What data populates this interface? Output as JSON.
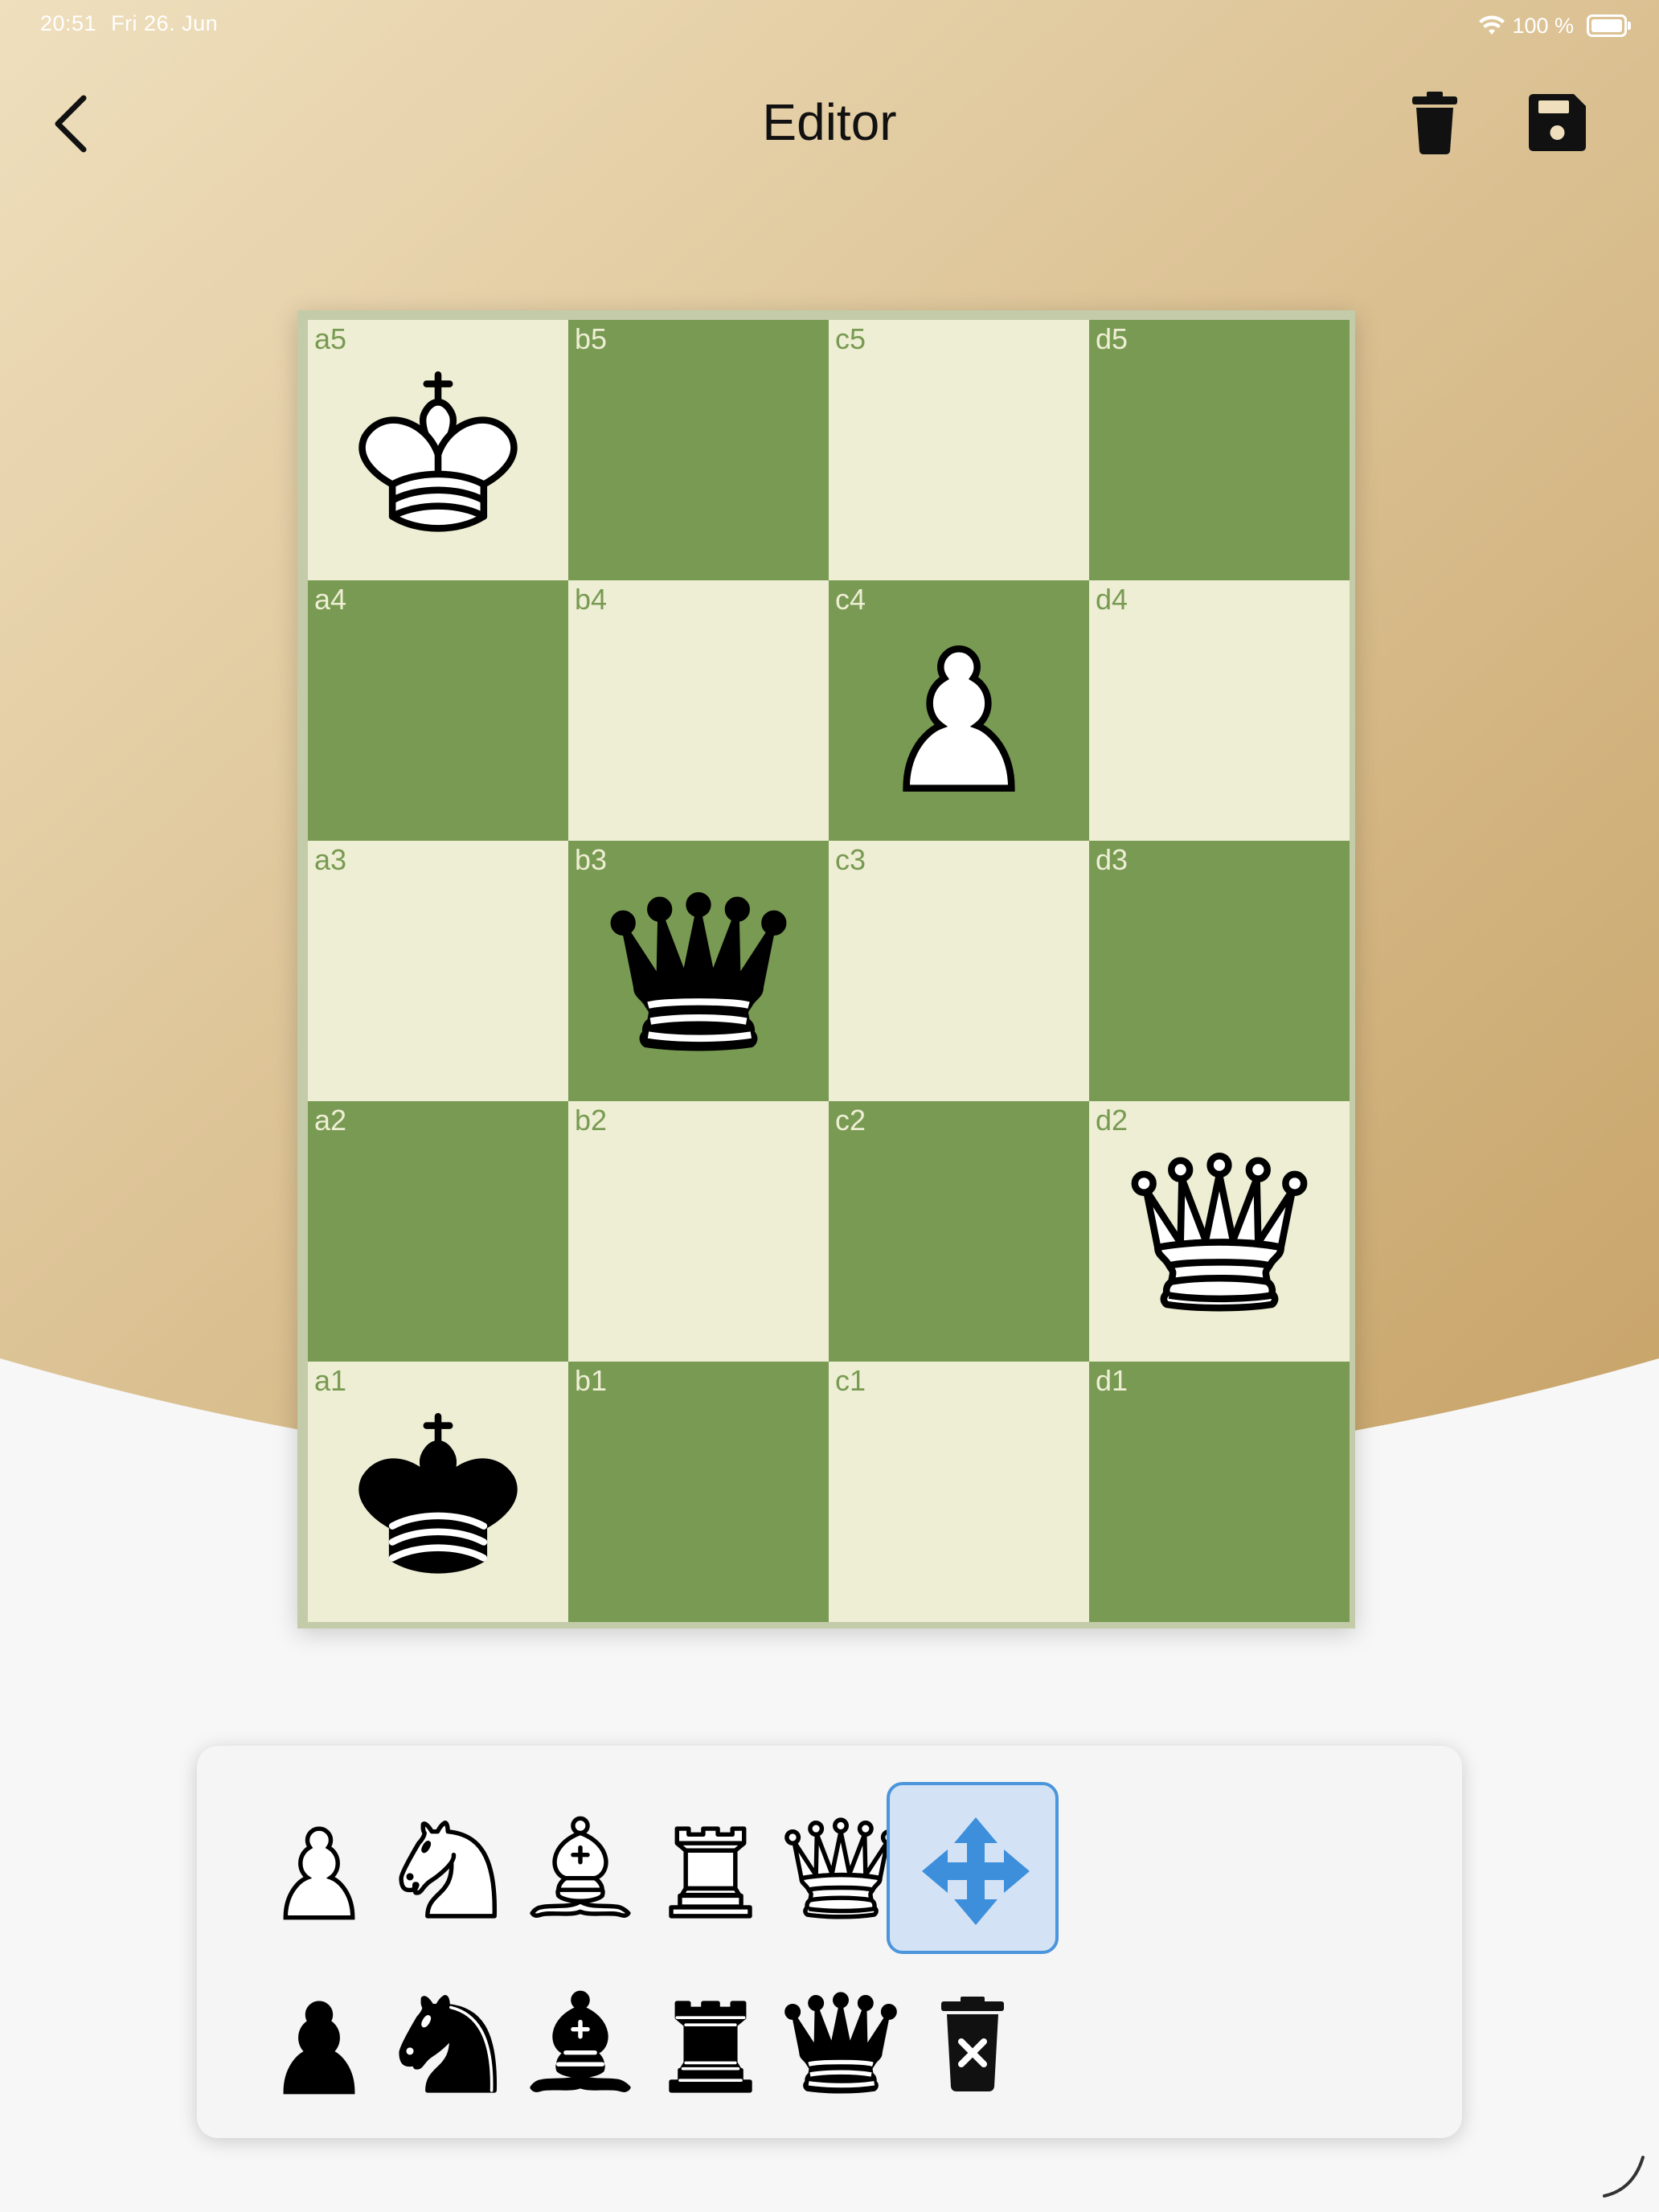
{
  "status_bar": {
    "time": "20:51",
    "date": "Fri 26. Jun",
    "battery": "100 %"
  },
  "nav": {
    "title": "Editor",
    "back_icon": "chevron-left-icon",
    "trash_icon": "trash-icon",
    "save_icon": "floppy-disk-icon"
  },
  "colors": {
    "header_gradient_start": "#eedcb8",
    "header_gradient_end": "#c8a46a",
    "dark_square": "#789a52",
    "light_square": "#eeeed4",
    "selection_fill": "#d3e3f5",
    "selection_border": "#4a95dc",
    "move_icon": "#3d8fdc"
  },
  "board": {
    "files": [
      "a",
      "b",
      "c",
      "d"
    ],
    "ranks": [
      5,
      4,
      3,
      2,
      1
    ],
    "pieces": [
      {
        "square": "a5",
        "piece": "king",
        "color": "white"
      },
      {
        "square": "c4",
        "piece": "pawn",
        "color": "white"
      },
      {
        "square": "b3",
        "piece": "queen",
        "color": "black"
      },
      {
        "square": "d2",
        "piece": "queen",
        "color": "white"
      },
      {
        "square": "a1",
        "piece": "king",
        "color": "black"
      }
    ]
  },
  "palette": {
    "rows": [
      [
        {
          "name": "palette-white-pawn",
          "piece": "pawn",
          "color": "white"
        },
        {
          "name": "palette-white-knight",
          "piece": "knight",
          "color": "white"
        },
        {
          "name": "palette-white-bishop",
          "piece": "bishop",
          "color": "white"
        },
        {
          "name": "palette-white-rook",
          "piece": "rook",
          "color": "white"
        },
        {
          "name": "palette-white-queen",
          "piece": "queen",
          "color": "white"
        },
        {
          "name": "palette-move-tool",
          "tool": "move",
          "icon": "move-arrows-icon",
          "selected": true
        }
      ],
      [
        {
          "name": "palette-black-pawn",
          "piece": "pawn",
          "color": "black"
        },
        {
          "name": "palette-black-knight",
          "piece": "knight",
          "color": "black"
        },
        {
          "name": "palette-black-bishop",
          "piece": "bishop",
          "color": "black"
        },
        {
          "name": "palette-black-rook",
          "piece": "rook",
          "color": "black"
        },
        {
          "name": "palette-black-queen",
          "piece": "queen",
          "color": "black"
        },
        {
          "name": "palette-delete-tool",
          "tool": "delete",
          "icon": "trash-x-icon",
          "selected": false
        }
      ]
    ]
  }
}
